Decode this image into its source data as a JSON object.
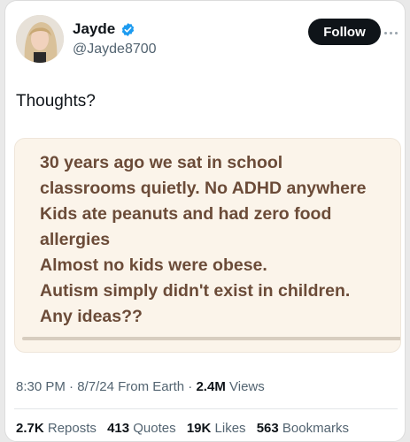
{
  "author": {
    "name": "Jayde",
    "handle": "@Jayde8700",
    "verified_color": "#1d9bf0"
  },
  "follow_label": "Follow",
  "tweet_text": "Thoughts?",
  "image": {
    "background_color": "#fbf4ea",
    "text_color": "#6b4b38",
    "lines": [
      "30 years ago we sat in school",
      "classrooms quietly. No ADHD anywhere",
      "Kids ate peanuts and had zero food",
      "allergies",
      "Almost no kids were obese.",
      "Autism simply didn't exist in children.",
      "Any ideas??"
    ]
  },
  "meta": {
    "time": "8:30 PM",
    "date": "8/7/24",
    "source": "From Earth",
    "views_count": "2.4M",
    "views_label": "Views"
  },
  "stats": {
    "reposts_count": "2.7K",
    "reposts_label": "Reposts",
    "quotes_count": "413",
    "quotes_label": "Quotes",
    "likes_count": "19K",
    "likes_label": "Likes",
    "bookmarks_count": "563",
    "bookmarks_label": "Bookmarks"
  }
}
